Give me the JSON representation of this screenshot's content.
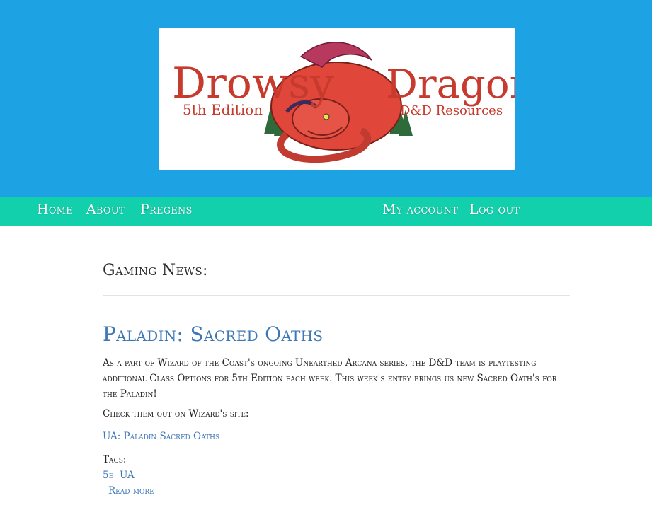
{
  "logo": {
    "word1": "Drowsy",
    "word2": "Dragon",
    "subtitle_left": "5th Edition",
    "subtitle_right": "D&D Resources"
  },
  "nav": {
    "home": "Home",
    "about": "About",
    "pregens": "Pregens",
    "my_account": "My account",
    "log_out": "Log out"
  },
  "main": {
    "section_title": "Gaming News:",
    "post": {
      "title": "Paladin: Sacred Oaths",
      "body": "As a part of Wizard of the Coast's ongoing Unearthed Arcana series, the D&D team is playtesting additional Class Options for 5th Edition each week. This week's entry brings us new Sacred Oath's for the Paladin!",
      "check": "Check them out on Wizard's site:",
      "link": "UA: Paladin Sacred Oaths",
      "tags_label": "Tags:",
      "tags": [
        "5e",
        "UA"
      ],
      "read_more": "Read more"
    }
  },
  "colors": {
    "header_bg": "#1da3e4",
    "nav_bg": "#12d0ac",
    "link": "#3e78b4",
    "logo_text": "#c73a2e",
    "dragon": "#e0473a"
  }
}
